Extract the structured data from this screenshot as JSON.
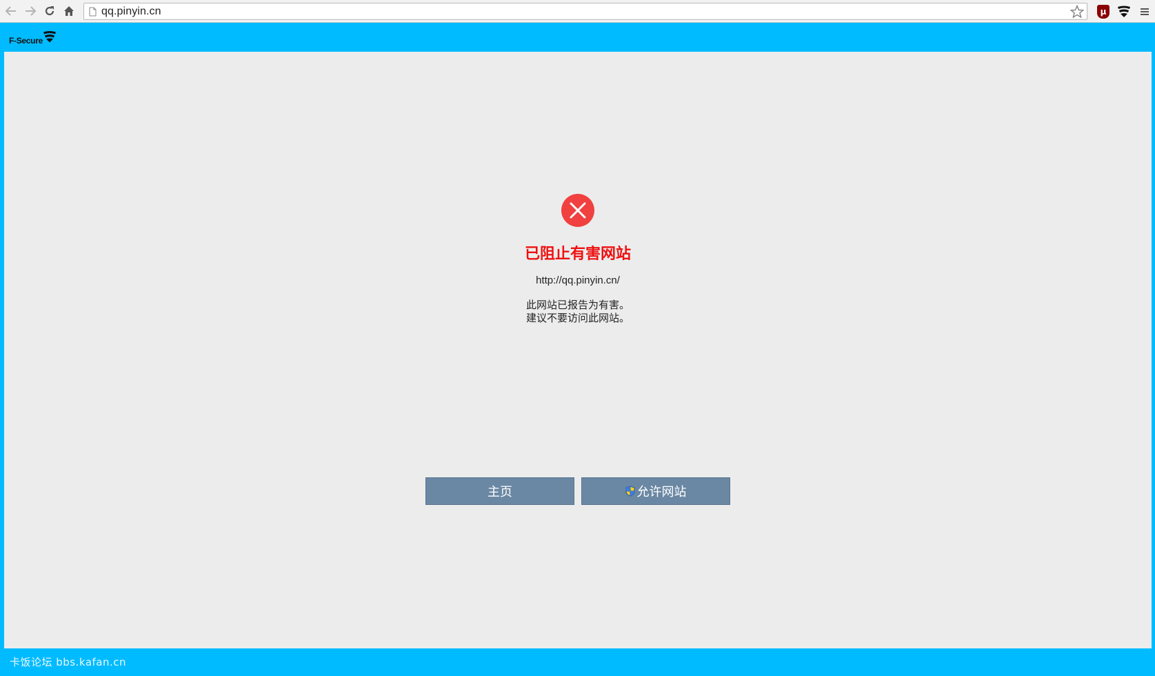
{
  "browser": {
    "url": "qq.pinyin.cn",
    "icons": {
      "back": "arrow-left-icon",
      "forward": "arrow-right-icon",
      "reload": "reload-icon",
      "home": "home-icon",
      "page": "page-icon",
      "bookmark": "star-icon",
      "extension1": "ublock-icon",
      "extension2": "fsecure-icon",
      "menu": "hamburger-menu-icon"
    },
    "ublock_glyph": "μ"
  },
  "header": {
    "brand": "F-Secure"
  },
  "block_page": {
    "title": "已阻止有害网站",
    "blocked_url": "http://qq.pinyin.cn/",
    "description_line1": "此网站已报告为有害。",
    "description_line2": "建议不要访问此网站。",
    "home_button": "主页",
    "allow_button": "允许网站"
  },
  "footer": {
    "watermark": "卡饭论坛 bbs.kafan.cn"
  },
  "colors": {
    "frame": "#00bbff",
    "content_bg": "#ececec",
    "headline": "#ee1111",
    "button": "#6a87a3",
    "error_icon": "#f04040"
  }
}
